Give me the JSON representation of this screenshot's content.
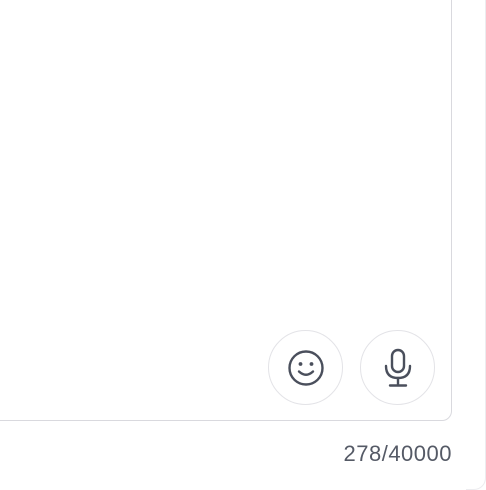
{
  "composer": {
    "message_value": "",
    "character_counter": "278/40000"
  },
  "icons": {
    "emoji": "smiley-face-icon",
    "voice": "microphone-icon"
  },
  "colors": {
    "icon_stroke": "#4a4f5c",
    "border": "#d9d9de",
    "counter_text": "#555a66"
  }
}
